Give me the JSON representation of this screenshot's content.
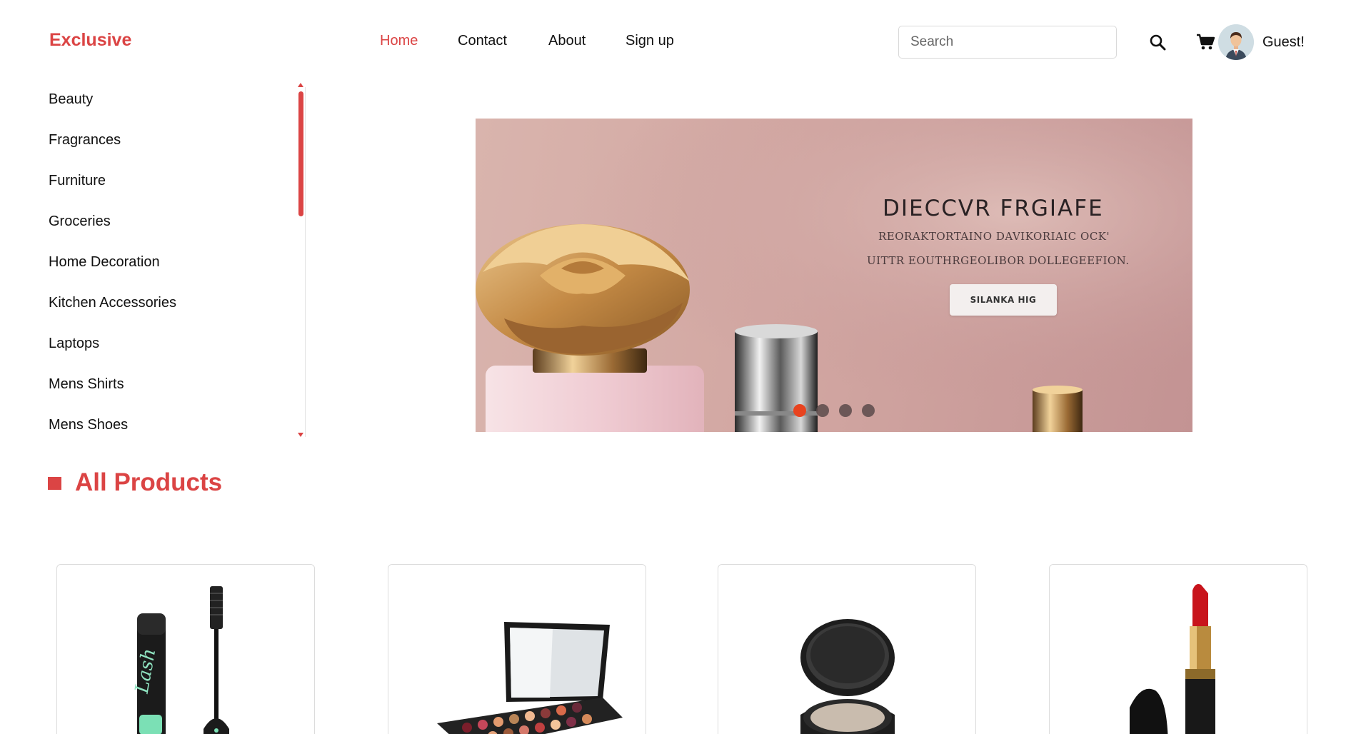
{
  "header": {
    "logo": "Exclusive",
    "nav": [
      {
        "label": "Home",
        "active": true
      },
      {
        "label": "Contact",
        "active": false
      },
      {
        "label": "About",
        "active": false
      },
      {
        "label": "Sign up",
        "active": false
      }
    ],
    "search": {
      "placeholder": "Search",
      "value": ""
    },
    "icons": {
      "search": "search-icon",
      "cart": "cart-icon",
      "avatar": "user-avatar-icon"
    },
    "user_label": "Guest!"
  },
  "sidebar": {
    "items": [
      {
        "label": "Beauty"
      },
      {
        "label": "Fragrances"
      },
      {
        "label": "Furniture"
      },
      {
        "label": "Groceries"
      },
      {
        "label": "Home Decoration"
      },
      {
        "label": "Kitchen Accessories"
      },
      {
        "label": "Laptops"
      },
      {
        "label": "Mens Shirts"
      },
      {
        "label": "Mens Shoes"
      }
    ]
  },
  "banner": {
    "heading": "DIECCVR FRGIAFE",
    "subtitle_line1": "REORAKTORTAINO DAVIKORIAIC OCK'",
    "subtitle_line2": "UITTR EOUTHRGEOLIBOR DOLLEGEEFION.",
    "cta_label": "SILANKA HIG",
    "slide_count": 4,
    "active_slide": 1
  },
  "section": {
    "title": "All Products"
  },
  "products": [
    {
      "image": "mascara"
    },
    {
      "image": "eyeshadow-palette"
    },
    {
      "image": "powder-compact"
    },
    {
      "image": "red-lipstick"
    }
  ],
  "colors": {
    "accent": "#db4444",
    "active_dot": "#e8431f"
  }
}
